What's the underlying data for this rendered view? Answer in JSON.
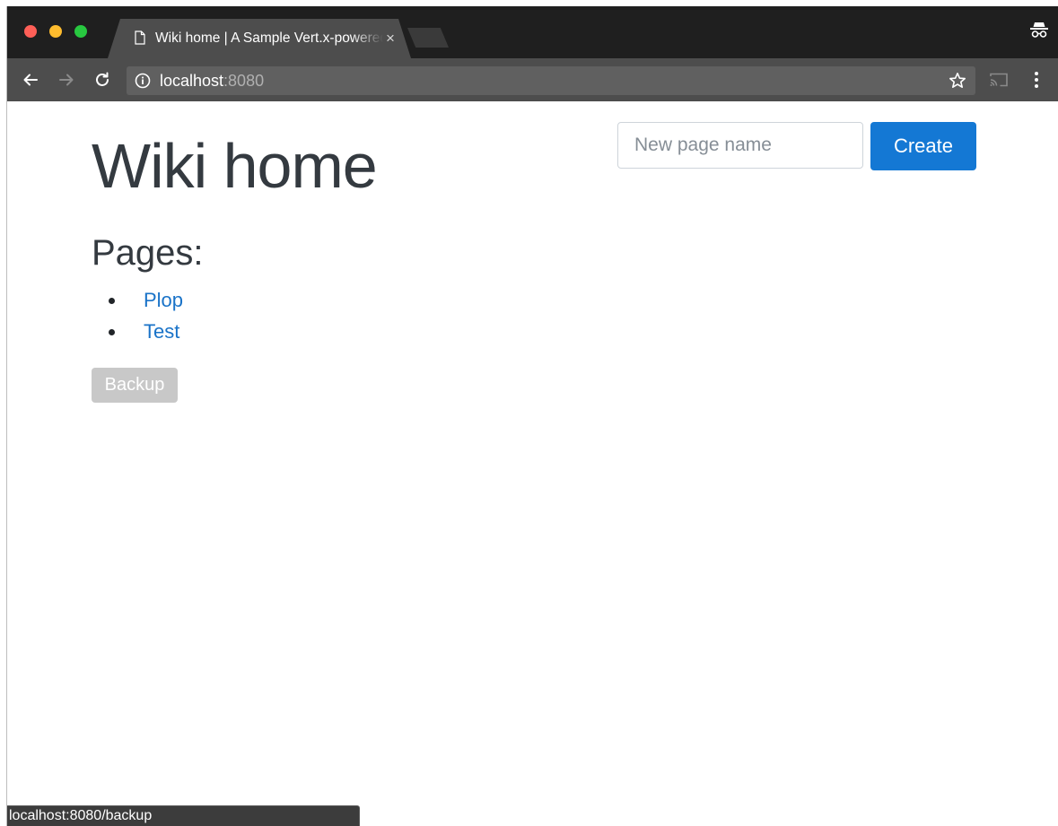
{
  "browser": {
    "tab": {
      "title": "Wiki home | A Sample Vert.x-powered wiki",
      "close_glyph": "×",
      "icon": "document-icon"
    },
    "address_bar": {
      "host": "localhost",
      "port": ":8080",
      "info_icon": "info-icon",
      "bookmark_icon": "star-icon"
    },
    "toolbar_icons": [
      "back-arrow-icon",
      "forward-arrow-icon",
      "reload-icon",
      "cast-icon",
      "menu-icon",
      "incognito-icon"
    ]
  },
  "page": {
    "title": "Wiki home",
    "create_form": {
      "placeholder": "New page name",
      "value": "",
      "button_label": "Create"
    },
    "pages_heading": "Pages:",
    "pages": [
      {
        "label": "Plop"
      },
      {
        "label": "Test"
      }
    ],
    "backup_label": "Backup"
  },
  "status_bar": {
    "url": "localhost:8080/backup"
  },
  "colors": {
    "primary": "#1478d4",
    "link": "#1a73c8",
    "disabled_button": "#c8c8c8",
    "heading_text": "#343a40"
  }
}
